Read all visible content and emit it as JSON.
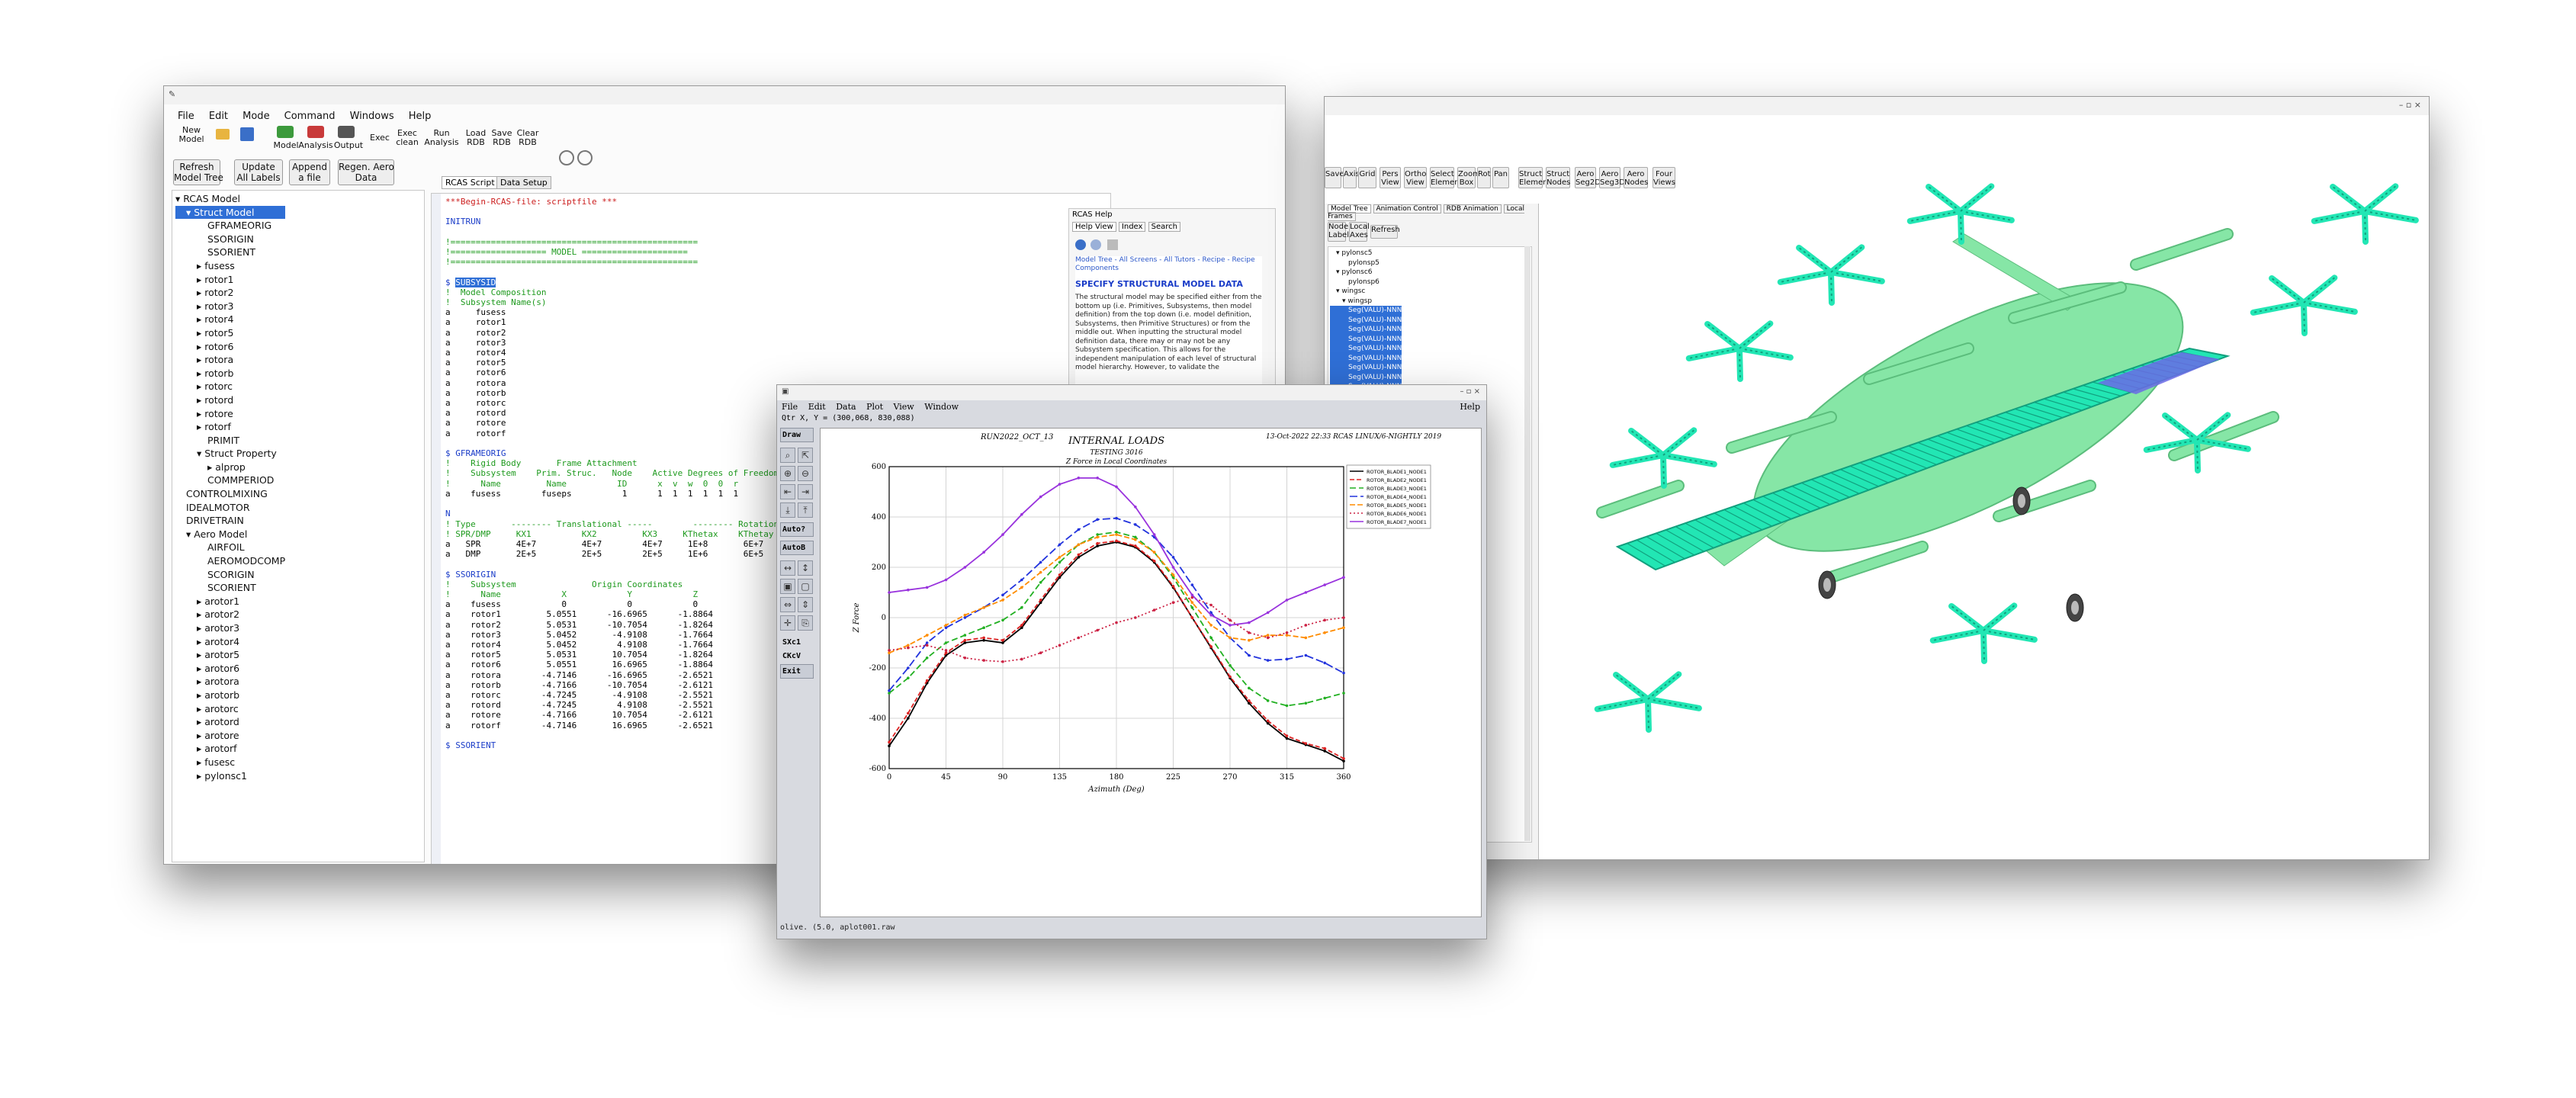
{
  "left_window": {
    "menu": [
      "File",
      "Edit",
      "Mode",
      "Command",
      "Windows",
      "Help"
    ],
    "toolbar": {
      "new_model": "New\nModel",
      "mode_model": "Model",
      "mode_analysis": "Analysis",
      "mode_output": "Output",
      "exec": "Exec",
      "exec_clean": "Exec\nclean",
      "run_analysis": "Run\nAnalysis",
      "load_rdb": "Load\nRDB",
      "save_rdb": "Save\nRDB",
      "clear_rdb": "Clear\nRDB"
    },
    "buttons": {
      "refresh": "Refresh\nModel Tree",
      "update": "Update\nAll Labels",
      "append": "Append\na file",
      "regen": "Regen. Aero\nData"
    },
    "tabs": [
      "RCAS Script",
      "Data Setup"
    ],
    "tree": [
      {
        "text": "▾ RCAS Model",
        "indent": 0
      },
      {
        "text": "▾ Struct Model",
        "indent": 1,
        "selected": true
      },
      {
        "text": "GFRAMEORIG",
        "indent": 3
      },
      {
        "text": "SSORIGIN",
        "indent": 3
      },
      {
        "text": "SSORIENT",
        "indent": 3
      },
      {
        "text": "▸ fusess",
        "indent": 2
      },
      {
        "text": "▸ rotor1",
        "indent": 2
      },
      {
        "text": "▸ rotor2",
        "indent": 2
      },
      {
        "text": "▸ rotor3",
        "indent": 2
      },
      {
        "text": "▸ rotor4",
        "indent": 2
      },
      {
        "text": "▸ rotor5",
        "indent": 2
      },
      {
        "text": "▸ rotor6",
        "indent": 2
      },
      {
        "text": "▸ rotora",
        "indent": 2
      },
      {
        "text": "▸ rotorb",
        "indent": 2
      },
      {
        "text": "▸ rotorc",
        "indent": 2
      },
      {
        "text": "▸ rotord",
        "indent": 2
      },
      {
        "text": "▸ rotore",
        "indent": 2
      },
      {
        "text": "▸ rotorf",
        "indent": 2
      },
      {
        "text": "PRIMIT",
        "indent": 3
      },
      {
        "text": "▾ Struct Property",
        "indent": 2
      },
      {
        "text": "▸ alprop",
        "indent": 3
      },
      {
        "text": "COMMPERIOD",
        "indent": 3
      },
      {
        "text": "CONTROLMIXING",
        "indent": 1
      },
      {
        "text": "IDEALMOTOR",
        "indent": 1
      },
      {
        "text": "DRIVETRAIN",
        "indent": 1
      },
      {
        "text": "▾ Aero Model",
        "indent": 1
      },
      {
        "text": "AIRFOIL",
        "indent": 3
      },
      {
        "text": "AEROMODCOMP",
        "indent": 3
      },
      {
        "text": "SCORIGIN",
        "indent": 3
      },
      {
        "text": "SCORIENT",
        "indent": 3
      },
      {
        "text": "▸ arotor1",
        "indent": 2
      },
      {
        "text": "▸ arotor2",
        "indent": 2
      },
      {
        "text": "▸ arotor3",
        "indent": 2
      },
      {
        "text": "▸ arotor4",
        "indent": 2
      },
      {
        "text": "▸ arotor5",
        "indent": 2
      },
      {
        "text": "▸ arotor6",
        "indent": 2
      },
      {
        "text": "▸ arotora",
        "indent": 2
      },
      {
        "text": "▸ arotorb",
        "indent": 2
      },
      {
        "text": "▸ arotorc",
        "indent": 2
      },
      {
        "text": "▸ arotord",
        "indent": 2
      },
      {
        "text": "▸ arotore",
        "indent": 2
      },
      {
        "text": "▸ arotorf",
        "indent": 2
      },
      {
        "text": "▸ fusesc",
        "indent": 2
      },
      {
        "text": "▸ pylonsc1",
        "indent": 2
      }
    ],
    "script_lines": [
      {
        "t": "***Begin-RCAS-file: scriptfile ***",
        "c": "#cc2020"
      },
      {
        "t": "",
        "c": "#000"
      },
      {
        "t": "INITRUN",
        "c": "#1a3cc8"
      },
      {
        "t": "",
        "c": "#000"
      },
      {
        "t": "!=================================================",
        "c": "#1e9a1e"
      },
      {
        "t": "!=================== MODEL =====================",
        "c": "#1e9a1e"
      },
      {
        "t": "!=================================================",
        "c": "#1e9a1e"
      },
      {
        "t": "",
        "c": "#000"
      },
      {
        "t": "$ SUBSYSID",
        "c": "#1a3cc8"
      },
      {
        "t": "!  Model Composition",
        "c": "#1e9a1e"
      },
      {
        "t": "!  Subsystem Name(s)",
        "c": "#1e9a1e"
      },
      {
        "t": "a     fusess",
        "c": "#000"
      },
      {
        "t": "a     rotor1",
        "c": "#000"
      },
      {
        "t": "a     rotor2",
        "c": "#000"
      },
      {
        "t": "a     rotor3",
        "c": "#000"
      },
      {
        "t": "a     rotor4",
        "c": "#000"
      },
      {
        "t": "a     rotor5",
        "c": "#000"
      },
      {
        "t": "a     rotor6",
        "c": "#000"
      },
      {
        "t": "a     rotora",
        "c": "#000"
      },
      {
        "t": "a     rotorb",
        "c": "#000"
      },
      {
        "t": "a     rotorc",
        "c": "#000"
      },
      {
        "t": "a     rotord",
        "c": "#000"
      },
      {
        "t": "a     rotore",
        "c": "#000"
      },
      {
        "t": "a     rotorf",
        "c": "#000"
      },
      {
        "t": "",
        "c": "#000"
      },
      {
        "t": "$ GFRAMEORIG",
        "c": "#1a3cc8"
      },
      {
        "t": "!    Rigid Body       Frame Attachment",
        "c": "#1e9a1e"
      },
      {
        "t": "!    Subsystem    Prim. Struc.   Node    Active Degrees of Freedom",
        "c": "#1e9a1e"
      },
      {
        "t": "!      Name         Name          ID      x  v  w  0  0  r",
        "c": "#1e9a1e"
      },
      {
        "t": "a    fusess        fuseps          1      1  1  1  1  1  1",
        "c": "#000"
      },
      {
        "t": "",
        "c": "#000"
      },
      {
        "t": "N",
        "c": "#1a3cc8"
      },
      {
        "t": "! Type       -------- Translational -----        -------- Rotational --",
        "c": "#1e9a1e"
      },
      {
        "t": "! SPR/DMP     KX1          KX2         KX3     KThetax    KThetay   KThetaz",
        "c": "#1e9a1e"
      },
      {
        "t": "a   SPR       4E+7         4E+7        4E+7     1E+8       6E+7      1E+8",
        "c": "#000"
      },
      {
        "t": "a   DMP       2E+5         2E+5        2E+5     1E+6       6E+5      1E+6",
        "c": "#000"
      },
      {
        "t": "",
        "c": "#000"
      },
      {
        "t": "$ SSORIGIN",
        "c": "#1a3cc8"
      },
      {
        "t": "!    Subsystem               Origin Coordinates",
        "c": "#1e9a1e"
      },
      {
        "t": "!      Name            X            Y            Z",
        "c": "#1e9a1e"
      },
      {
        "t": "a    fusess            0            0            0",
        "c": "#000"
      },
      {
        "t": "a    rotor1         5.0551      -16.6965      -1.8864",
        "c": "#000"
      },
      {
        "t": "a    rotor2         5.0531      -10.7054      -1.8264",
        "c": "#000"
      },
      {
        "t": "a    rotor3         5.0452       -4.9108      -1.7664",
        "c": "#000"
      },
      {
        "t": "a    rotor4         5.0452        4.9108      -1.7664",
        "c": "#000"
      },
      {
        "t": "a    rotor5         5.0531       10.7054      -1.8264",
        "c": "#000"
      },
      {
        "t": "a    rotor6         5.0551       16.6965      -1.8864",
        "c": "#000"
      },
      {
        "t": "a    rotora        -4.7146      -16.6965      -2.6521",
        "c": "#000"
      },
      {
        "t": "a    rotorb        -4.7166      -10.7054      -2.6121",
        "c": "#000"
      },
      {
        "t": "a    rotorc        -4.7245       -4.9108      -2.5521",
        "c": "#000"
      },
      {
        "t": "a    rotord        -4.7245        4.9108      -2.5521",
        "c": "#000"
      },
      {
        "t": "a    rotore        -4.7166       10.7054      -2.6121",
        "c": "#000"
      },
      {
        "t": "a    rotorf        -4.7146       16.6965      -2.6521",
        "c": "#000"
      },
      {
        "t": "",
        "c": "#000"
      },
      {
        "t": "$ SSORIENT",
        "c": "#1a3cc8"
      }
    ],
    "help": {
      "panel_title": "RCAS Help",
      "tabs": [
        "Help View",
        "Index",
        "Search"
      ],
      "breadcrumb": "Model Tree - All Screens - All Tutors - Recipe - Recipe Components",
      "heading": "SPECIFY STRUCTURAL MODEL DATA",
      "body": "The structural model may be specified either from the bottom up (i.e. Primitives, Subsystems, then model definition) from the top down (i.e. model definition, Subsystems, then Primitive Structures) or from the middle out. When inputting the structural model definition data, there may or may not be any Subsystem specification. This allows for the independent manipulation of each level of structural model hierarchy. However, to validate the"
    }
  },
  "right_window": {
    "toolbar": [
      {
        "label": "Save"
      },
      {
        "label": "Axis"
      },
      {
        "label": "Grid"
      },
      {
        "label": "Pers\nView"
      },
      {
        "label": "Ortho\nView"
      },
      {
        "label": "Select\nElement"
      },
      {
        "label": "Zoom\nBox"
      },
      {
        "label": "Rot"
      },
      {
        "label": "Pan"
      },
      {
        "label": "Struct\nElement"
      },
      {
        "label": "Struct\nNodes"
      },
      {
        "label": "Aero\nSeg2D"
      },
      {
        "label": "Aero\nSeg3D"
      },
      {
        "label": "Aero\nNodes"
      },
      {
        "label": "Four\nViews"
      }
    ],
    "tabs": [
      "Model Tree",
      "Animation Control",
      "RDB Animation",
      "Local Frames"
    ],
    "sub_buttons": [
      "Node\nLabel",
      "Local\nAxes",
      "Refresh"
    ],
    "tree": [
      {
        "text": "▾ pylonsc5",
        "indent": 1
      },
      {
        "text": "pylonsp5",
        "indent": 3
      },
      {
        "text": "▾ pylonsc6",
        "indent": 1
      },
      {
        "text": "pylonsp6",
        "indent": 3
      },
      {
        "text": "▾ wingsc",
        "indent": 1
      },
      {
        "text": "▾ wingsp",
        "indent": 2
      },
      {
        "text": "Seg(VALU)-NNN",
        "indent": 3,
        "selected": true
      },
      {
        "text": "Seg(VALU)-NNN",
        "indent": 3,
        "selected": true
      },
      {
        "text": "Seg(VALU)-NNN",
        "indent": 3,
        "selected": true
      },
      {
        "text": "Seg(VALU)-NNN",
        "indent": 3,
        "selected": true
      },
      {
        "text": "Seg(VALU)-NNN",
        "indent": 3,
        "selected": true
      },
      {
        "text": "Seg(VALU)-NNN",
        "indent": 3,
        "selected": true
      },
      {
        "text": "Seg(VALU)-NNN",
        "indent": 3,
        "selected": true
      },
      {
        "text": "Seg(VALU)-NNN",
        "indent": 3,
        "selected": true
      },
      {
        "text": "Seg(VALU)-NNN",
        "indent": 3,
        "selected": true
      }
    ]
  },
  "plot_window": {
    "menu": [
      "File",
      "Edit",
      "Data",
      "Plot",
      "View",
      "Window"
    ],
    "help": "Help",
    "coords": "Qtr X, Y = (300,068, 830,088)",
    "side_buttons": [
      "Draw",
      "Auto?",
      "AutoB",
      "SXc1",
      "CKcV",
      "Exit"
    ],
    "header_left": "RUN2022_OCT_13",
    "header_right": "13-Oct-2022 22:33 RCAS LINUX/6-NIGHTLY 2019",
    "status": "olive. (5.0, aplot001.raw"
  },
  "chart_data": {
    "type": "line",
    "title": "INTERNAL LOADS",
    "subtitle": "TESTING 3016",
    "subtitle2": "Z Force in Local Coordinates",
    "xlabel": "Azimuth (Deg)",
    "ylabel": "Z Force",
    "xlim": [
      0,
      360
    ],
    "ylim": [
      -600,
      600
    ],
    "xticks": [
      0,
      45,
      90,
      135,
      180,
      225,
      270,
      315,
      360
    ],
    "yticks": [
      -600,
      -400,
      -200,
      0,
      200,
      400,
      600
    ],
    "grid": true,
    "legend_position": "top-right",
    "x": [
      0,
      15,
      30,
      45,
      60,
      75,
      90,
      105,
      120,
      135,
      150,
      165,
      180,
      195,
      210,
      225,
      240,
      255,
      270,
      285,
      300,
      315,
      330,
      345,
      360
    ],
    "series": [
      {
        "name": "ROTOR_BLADE1_NODE1",
        "color": "#000000",
        "dash": "",
        "values": [
          -510,
          -400,
          -260,
          -150,
          -100,
          -90,
          -100,
          -40,
          60,
          160,
          240,
          285,
          300,
          280,
          220,
          120,
          0,
          -120,
          -240,
          -340,
          -420,
          -480,
          -505,
          -530,
          -570
        ]
      },
      {
        "name": "ROTOR_BLADE2_NODE1",
        "color": "#dd2222",
        "dash": "6,3",
        "values": [
          -495,
          -380,
          -250,
          -140,
          -90,
          -80,
          -90,
          -30,
          70,
          170,
          250,
          295,
          305,
          285,
          225,
          125,
          0,
          -115,
          -235,
          -330,
          -410,
          -470,
          -500,
          -520,
          -560
        ]
      },
      {
        "name": "ROTOR_BLADE3_NODE1",
        "color": "#22b022",
        "dash": "8,4",
        "values": [
          -300,
          -240,
          -160,
          -100,
          -70,
          -40,
          -10,
          40,
          140,
          220,
          290,
          330,
          340,
          320,
          260,
          160,
          40,
          -80,
          -190,
          -280,
          -330,
          -350,
          -340,
          -320,
          -300
        ]
      },
      {
        "name": "ROTOR_BLADE4_NODE1",
        "color": "#2233dd",
        "dash": "10,4",
        "values": [
          -290,
          -200,
          -100,
          -40,
          0,
          40,
          90,
          150,
          220,
          290,
          350,
          390,
          395,
          370,
          320,
          240,
          130,
          20,
          -80,
          -150,
          -170,
          -165,
          -150,
          -180,
          -220
        ]
      },
      {
        "name": "ROTOR_BLADE5_NODE1",
        "color": "#ff8c00",
        "dash": "7,3",
        "values": [
          -140,
          -110,
          -70,
          -30,
          10,
          40,
          70,
          120,
          180,
          240,
          290,
          320,
          330,
          310,
          260,
          170,
          60,
          -30,
          -80,
          -90,
          -70,
          -70,
          -80,
          -60,
          -40
        ]
      },
      {
        "name": "ROTOR_BLADE6_NODE1",
        "color": "#cc2244",
        "dash": "2,3",
        "values": [
          -130,
          -120,
          -110,
          -130,
          -160,
          -170,
          -175,
          -165,
          -140,
          -110,
          -80,
          -50,
          -20,
          0,
          30,
          60,
          80,
          50,
          -10,
          -60,
          -80,
          -60,
          -30,
          -10,
          0
        ]
      },
      {
        "name": "ROTOR_BLADE7_NODE1",
        "color": "#9933dd",
        "dash": "",
        "values": [
          100,
          110,
          120,
          150,
          200,
          260,
          330,
          410,
          480,
          530,
          555,
          555,
          520,
          440,
          330,
          200,
          90,
          10,
          -30,
          -20,
          20,
          70,
          100,
          130,
          160
        ]
      }
    ]
  }
}
